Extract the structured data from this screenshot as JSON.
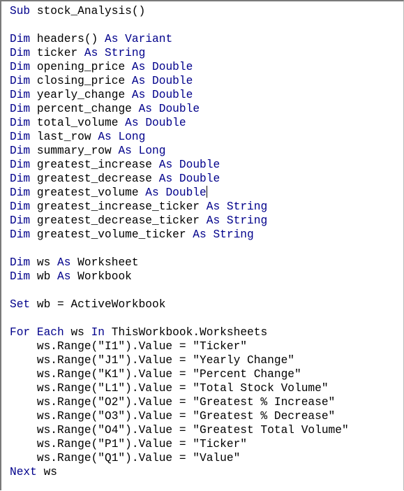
{
  "colors": {
    "keyword": "#00008b",
    "text": "#000000",
    "background": "#ffffff"
  },
  "code": {
    "lines": [
      [
        {
          "t": "Sub",
          "kw": true
        },
        {
          "t": " stock_Analysis()"
        }
      ],
      [],
      [
        {
          "t": "Dim",
          "kw": true
        },
        {
          "t": " headers() "
        },
        {
          "t": "As",
          "kw": true
        },
        {
          "t": " "
        },
        {
          "t": "Variant",
          "kw": true
        }
      ],
      [
        {
          "t": "Dim",
          "kw": true
        },
        {
          "t": " ticker "
        },
        {
          "t": "As",
          "kw": true
        },
        {
          "t": " "
        },
        {
          "t": "String",
          "kw": true
        }
      ],
      [
        {
          "t": "Dim",
          "kw": true
        },
        {
          "t": " opening_price "
        },
        {
          "t": "As",
          "kw": true
        },
        {
          "t": " "
        },
        {
          "t": "Double",
          "kw": true
        }
      ],
      [
        {
          "t": "Dim",
          "kw": true
        },
        {
          "t": " closing_price "
        },
        {
          "t": "As",
          "kw": true
        },
        {
          "t": " "
        },
        {
          "t": "Double",
          "kw": true
        }
      ],
      [
        {
          "t": "Dim",
          "kw": true
        },
        {
          "t": " yearly_change "
        },
        {
          "t": "As",
          "kw": true
        },
        {
          "t": " "
        },
        {
          "t": "Double",
          "kw": true
        }
      ],
      [
        {
          "t": "Dim",
          "kw": true
        },
        {
          "t": " percent_change "
        },
        {
          "t": "As",
          "kw": true
        },
        {
          "t": " "
        },
        {
          "t": "Double",
          "kw": true
        }
      ],
      [
        {
          "t": "Dim",
          "kw": true
        },
        {
          "t": " total_volume "
        },
        {
          "t": "As",
          "kw": true
        },
        {
          "t": " "
        },
        {
          "t": "Double",
          "kw": true
        }
      ],
      [
        {
          "t": "Dim",
          "kw": true
        },
        {
          "t": " last_row "
        },
        {
          "t": "As",
          "kw": true
        },
        {
          "t": " "
        },
        {
          "t": "Long",
          "kw": true
        }
      ],
      [
        {
          "t": "Dim",
          "kw": true
        },
        {
          "t": " summary_row "
        },
        {
          "t": "As",
          "kw": true
        },
        {
          "t": " "
        },
        {
          "t": "Long",
          "kw": true
        }
      ],
      [
        {
          "t": "Dim",
          "kw": true
        },
        {
          "t": " greatest_increase "
        },
        {
          "t": "As",
          "kw": true
        },
        {
          "t": " "
        },
        {
          "t": "Double",
          "kw": true
        }
      ],
      [
        {
          "t": "Dim",
          "kw": true
        },
        {
          "t": " greatest_decrease "
        },
        {
          "t": "As",
          "kw": true
        },
        {
          "t": " "
        },
        {
          "t": "Double",
          "kw": true
        }
      ],
      [
        {
          "t": "Dim",
          "kw": true
        },
        {
          "t": " greatest_volume "
        },
        {
          "t": "As",
          "kw": true
        },
        {
          "t": " "
        },
        {
          "t": "Double",
          "kw": true
        },
        {
          "caret": true
        }
      ],
      [
        {
          "t": "Dim",
          "kw": true
        },
        {
          "t": " greatest_increase_ticker "
        },
        {
          "t": "As",
          "kw": true
        },
        {
          "t": " "
        },
        {
          "t": "String",
          "kw": true
        }
      ],
      [
        {
          "t": "Dim",
          "kw": true
        },
        {
          "t": " greatest_decrease_ticker "
        },
        {
          "t": "As",
          "kw": true
        },
        {
          "t": " "
        },
        {
          "t": "String",
          "kw": true
        }
      ],
      [
        {
          "t": "Dim",
          "kw": true
        },
        {
          "t": " greatest_volume_ticker "
        },
        {
          "t": "As",
          "kw": true
        },
        {
          "t": " "
        },
        {
          "t": "String",
          "kw": true
        }
      ],
      [],
      [
        {
          "t": "Dim",
          "kw": true
        },
        {
          "t": " ws "
        },
        {
          "t": "As",
          "kw": true
        },
        {
          "t": " Worksheet"
        }
      ],
      [
        {
          "t": "Dim",
          "kw": true
        },
        {
          "t": " wb "
        },
        {
          "t": "As",
          "kw": true
        },
        {
          "t": " Workbook"
        }
      ],
      [],
      [
        {
          "t": "Set",
          "kw": true
        },
        {
          "t": " wb = ActiveWorkbook"
        }
      ],
      [],
      [
        {
          "t": "For",
          "kw": true
        },
        {
          "t": " "
        },
        {
          "t": "Each",
          "kw": true
        },
        {
          "t": " ws "
        },
        {
          "t": "In",
          "kw": true
        },
        {
          "t": " ThisWorkbook.Worksheets"
        }
      ],
      [
        {
          "t": "    ws.Range(\"I1\").Value = \"Ticker\""
        }
      ],
      [
        {
          "t": "    ws.Range(\"J1\").Value = \"Yearly Change\""
        }
      ],
      [
        {
          "t": "    ws.Range(\"K1\").Value = \"Percent Change\""
        }
      ],
      [
        {
          "t": "    ws.Range(\"L1\").Value = \"Total Stock Volume\""
        }
      ],
      [
        {
          "t": "    ws.Range(\"O2\").Value = \"Greatest % Increase\""
        }
      ],
      [
        {
          "t": "    ws.Range(\"O3\").Value = \"Greatest % Decrease\""
        }
      ],
      [
        {
          "t": "    ws.Range(\"O4\").Value = \"Greatest Total Volume\""
        }
      ],
      [
        {
          "t": "    ws.Range(\"P1\").Value = \"Ticker\""
        }
      ],
      [
        {
          "t": "    ws.Range(\"Q1\").Value = \"Value\""
        }
      ],
      [
        {
          "t": "Next",
          "kw": true
        },
        {
          "t": " ws"
        }
      ]
    ]
  }
}
